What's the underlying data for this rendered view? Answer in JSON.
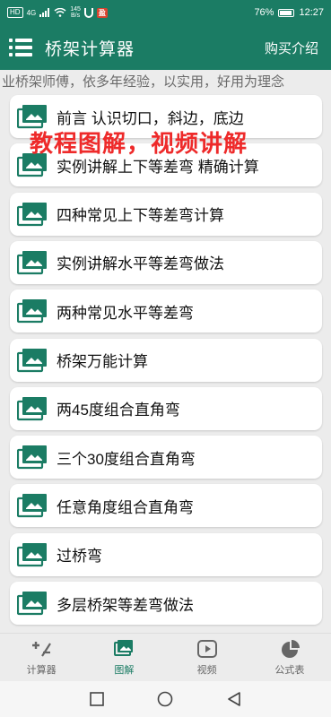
{
  "status": {
    "network_chip": "HD",
    "signal": "4G",
    "speed": "145",
    "speed_unit": "B/s",
    "battery": "76%",
    "time": "12:27",
    "badge": "盈"
  },
  "app": {
    "title": "桥架计算器",
    "buy_label": "购买介绍"
  },
  "marquee": "业桥架师傅，依多年经验，以实用，好用为理念",
  "overlay": "教程图解，视频讲解",
  "items": [
    {
      "label": "前言  认识切口，斜边，底边"
    },
    {
      "label": "实例讲解上下等差弯 精确计算"
    },
    {
      "label": "四种常见上下等差弯计算"
    },
    {
      "label": "实例讲解水平等差弯做法"
    },
    {
      "label": "两种常见水平等差弯"
    },
    {
      "label": "桥架万能计算"
    },
    {
      "label": "两45度组合直角弯"
    },
    {
      "label": "三个30度组合直角弯"
    },
    {
      "label": "任意角度组合直角弯"
    },
    {
      "label": "过桥弯"
    },
    {
      "label": "多层桥架等差弯做法"
    }
  ],
  "tabs": [
    {
      "label": "计算器",
      "icon": "calculator-icon"
    },
    {
      "label": "图解",
      "icon": "image-icon",
      "active": true
    },
    {
      "label": "视频",
      "icon": "video-icon"
    },
    {
      "label": "公式表",
      "icon": "pie-chart-icon"
    }
  ],
  "colors": {
    "primary": "#1b7c64",
    "overlay_text": "#ee2a2a"
  }
}
